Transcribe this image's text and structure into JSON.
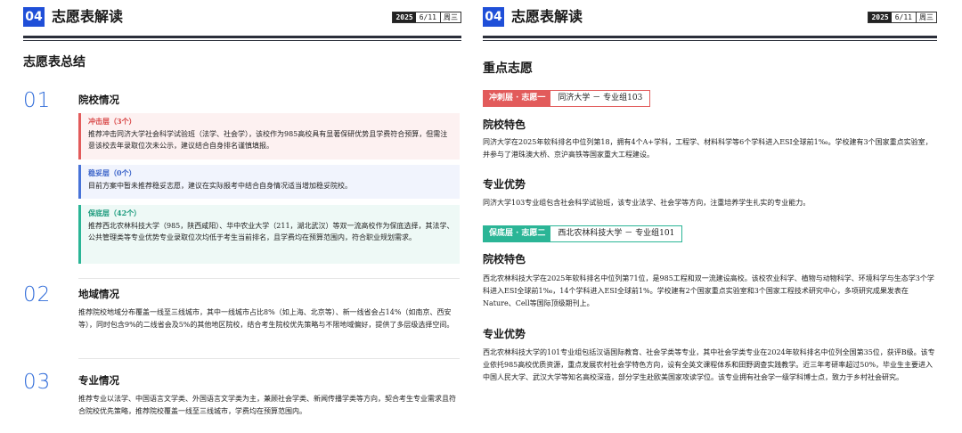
{
  "left": {
    "header": {
      "number": "04",
      "title": "志愿表解读",
      "year": "2025",
      "day": "6/11",
      "weekday": "周三"
    },
    "section_title": "志愿表总结",
    "rows": [
      {
        "number": "01",
        "title": "院校情况"
      },
      {
        "number": "02",
        "title": "地域情况"
      },
      {
        "number": "03",
        "title": "专业情况"
      }
    ],
    "callouts": [
      {
        "title": "冲击层（3个）",
        "text": "推荐冲击同济大学社会科学试验班（法学、社会学），该校作为985高校具有显著保研优势且学费符合预算，但需注意该校去年录取位次未公示，建议结合自身排名谨慎填报。"
      },
      {
        "title": "稳妥层（0个）",
        "text": "目前方案中暂未推荐稳妥志愿，建议在实际报考中结合自身情况适当增加稳妥院校。"
      },
      {
        "title": "保底层（42个）",
        "text": "推荐西北农林科技大学（985，陕西咸阳）、华中农业大学（211，湖北武汉）等双一流高校作为保底选择，其法学、公共管理类等专业优势专业录取位次均低于考生当前排名，且学费均在预算范围内，符合职业规划需求。"
      }
    ],
    "region_text": "推荐院校地域分布覆盖一线至三线城市，其中一线城市占比8%（如上海、北京等）、新一线省会占14%（如南京、西安等），同时包含9%的二线省会及5%的其他地区院校，结合考生院校优先策略与不限地域偏好，提供了多层级选择空间。",
    "major_text": "推荐专业以法学、中国语言文学类、外国语言文学类为主，兼顾社会学类、新闻传播学类等方向，契合考生专业需求且符合院校优先策略，推荐院校覆盖一线至三线城市，学费均在预算范围内。"
  },
  "right": {
    "header": {
      "number": "04",
      "title": "志愿表解读",
      "year": "2025",
      "day": "6/11",
      "weekday": "周三"
    },
    "section_title": "重点志愿",
    "tag1": {
      "key": "冲刺层 · 志愿一",
      "value": "同济大学 － 专业组103"
    },
    "head1a": "院校特色",
    "text1a": "同济大学在2025年软科排名中位列第18，拥有4个A+学科，工程学、材料科学等6个学科进入ESI全球前1‰。学校建有3个国家重点实验室，并参与了港珠澳大桥、京沪高铁等国家重大工程建设。",
    "head1b": "专业优势",
    "text1b": "同济大学103专业组包含社会科学试验班，该专业法学、社会学等方向，注重培养学生扎实的专业能力。",
    "tag2": {
      "key": "保底层 · 志愿二",
      "value": "西北农林科技大学 － 专业组101"
    },
    "head2a": "院校特色",
    "text2a": "西北农林科技大学在2025年软科排名中位列第71位，是985工程和双一流建设高校。该校农业科学、植物与动物科学、环境科学与生态学3个学科进入ESI全球前1‰，14个学科进入ESI全球前1%。学校建有2个国家重点实验室和3个国家工程技术研究中心，多项研究成果发表在Nature、Cell等国际顶级期刊上。",
    "head2b": "专业优势",
    "text2b": "西北农林科技大学的101专业组包括汉语国际教育、社会学类等专业，其中社会学类专业在2024年软科排名中位列全国第35位，获评B级。该专业依托985高校优质资源，重点发展农村社会学特色方向，设有全英文课程体系和田野调查实践教学。近三年考研率超过50%，毕业生主要进入中国人民大学、武汉大学等知名高校深造，部分学生赴欧美国家攻读学位。该专业拥有社会学一级学科博士点，致力于乡村社会研究。"
  }
}
